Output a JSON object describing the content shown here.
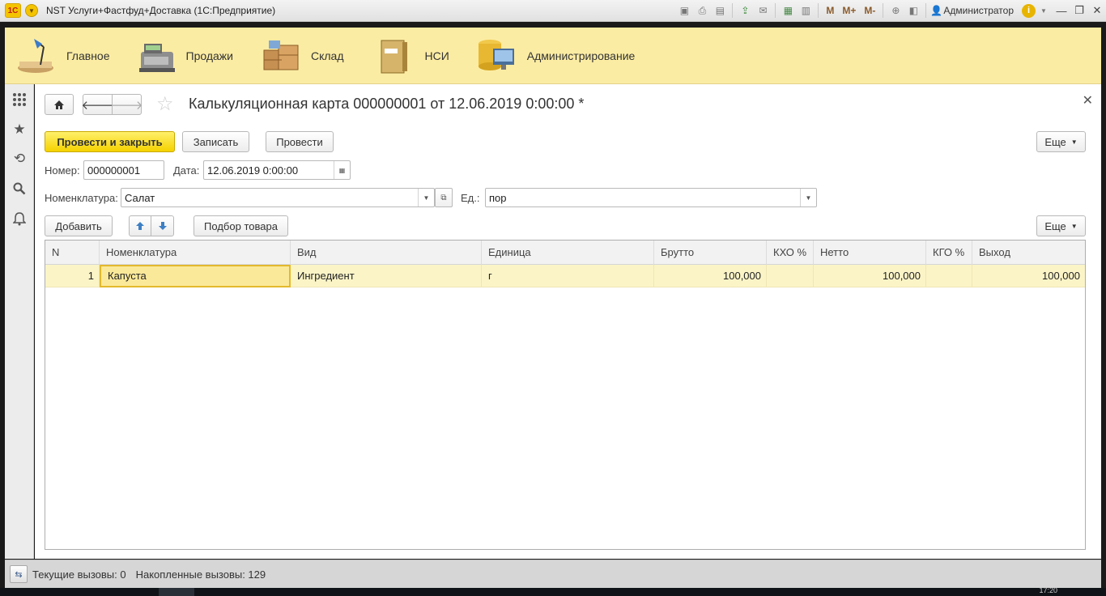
{
  "window": {
    "title": "NST Услуги+Фастфуд+Доставка  (1С:Предприятие)",
    "logo_text": "1С",
    "user": "Администратор",
    "toolbar_m": [
      "M",
      "M+",
      "M-"
    ]
  },
  "sections": [
    {
      "label": "Главное",
      "icon": "desk-lamp-icon"
    },
    {
      "label": "Продажи",
      "icon": "cash-register-icon"
    },
    {
      "label": "Склад",
      "icon": "crates-icon"
    },
    {
      "label": "НСИ",
      "icon": "folder-binder-icon"
    },
    {
      "label": "Администрирование",
      "icon": "database-monitor-icon"
    }
  ],
  "leftbar": [
    "apps-grid-icon",
    "favorites-star-icon",
    "history-icon",
    "search-icon",
    "notifications-bell-icon"
  ],
  "document": {
    "title": "Калькуляционная карта 000000001 от 12.06.2019 0:00:00 *",
    "btn_post_close": "Провести и закрыть",
    "btn_save": "Записать",
    "btn_post": "Провести",
    "btn_more": "Еще",
    "number_label": "Номер:",
    "number_value": "000000001",
    "date_label": "Дата:",
    "date_value": "12.06.2019  0:00:00",
    "nomenclature_label": "Номенклатура:",
    "nomenclature_value": "Салат",
    "unit_label": "Ед.:",
    "unit_value": "пор"
  },
  "table_toolbar": {
    "add": "Добавить",
    "pick": "Подбор товара",
    "more": "Еще"
  },
  "table": {
    "columns": [
      "N",
      "Номенклатура",
      "Вид",
      "Единица",
      "Брутто",
      "КХО %",
      "Нетто",
      "КГО %",
      "Выход"
    ],
    "rows": [
      [
        "1",
        "Капуста",
        "Ингредиент",
        "г",
        "100,000",
        "",
        "100,000",
        "",
        "100,000"
      ]
    ]
  },
  "status": {
    "current_calls": "Текущие вызовы: 0",
    "accumulated_calls": "Накопленные вызовы: 129"
  },
  "clock": "17:20"
}
